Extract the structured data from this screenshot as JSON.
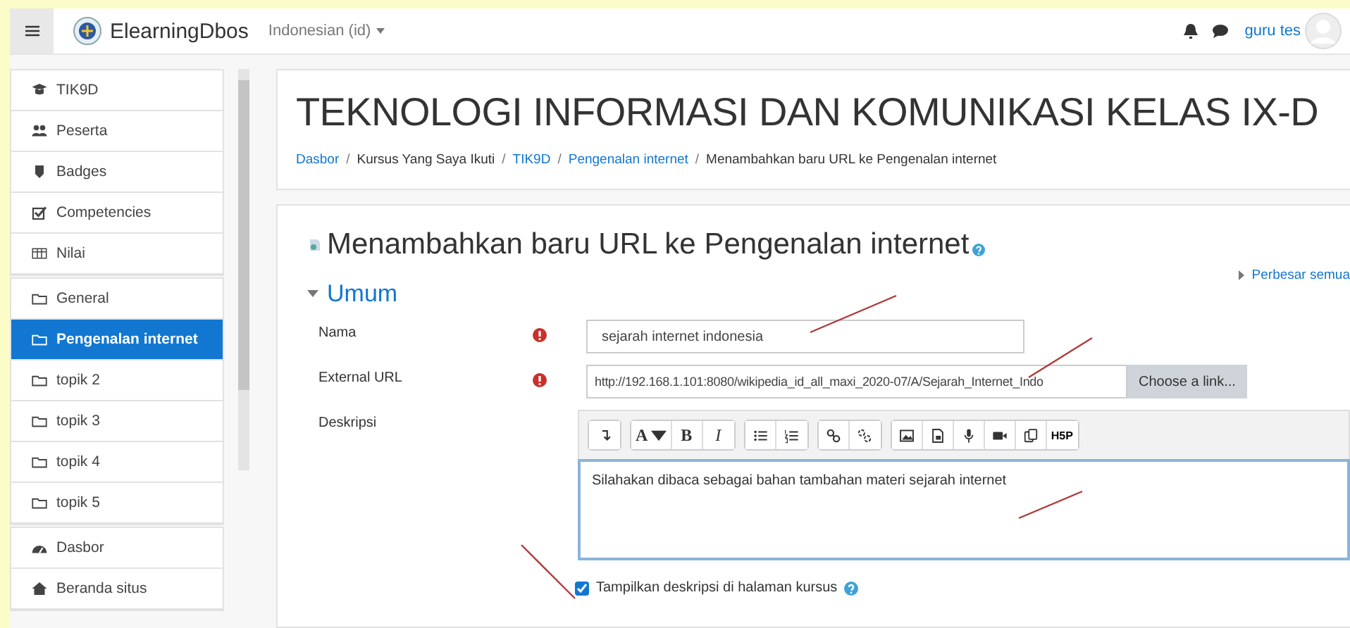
{
  "navbar": {
    "site_name": "ElearningDbos",
    "language": "Indonesian (id)",
    "user_name": "guru tes"
  },
  "sidebar": {
    "groups": [
      {
        "items": [
          {
            "label": "TIK9D",
            "kind": "cap",
            "selected": false
          },
          {
            "label": "Peserta",
            "kind": "users",
            "selected": false
          },
          {
            "label": "Badges",
            "kind": "shield",
            "selected": false
          },
          {
            "label": "Competencies",
            "kind": "check",
            "selected": false
          },
          {
            "label": "Nilai",
            "kind": "table",
            "selected": false
          }
        ]
      },
      {
        "items": [
          {
            "label": "General",
            "kind": "folder",
            "selected": false
          },
          {
            "label": "Pengenalan internet",
            "kind": "folder",
            "selected": true
          },
          {
            "label": "topik 2",
            "kind": "folder",
            "selected": false
          },
          {
            "label": "topik 3",
            "kind": "folder",
            "selected": false
          },
          {
            "label": "topik 4",
            "kind": "folder",
            "selected": false
          },
          {
            "label": "topik 5",
            "kind": "folder",
            "selected": false
          }
        ]
      },
      {
        "items": [
          {
            "label": "Dasbor",
            "kind": "dashboard",
            "selected": false
          },
          {
            "label": "Beranda situs",
            "kind": "home",
            "selected": false
          }
        ]
      }
    ]
  },
  "header": {
    "title": "TEKNOLOGI INFORMASI DAN KOMUNIKASI KELAS IX-D",
    "separator": "/",
    "breadcrumbs": [
      {
        "label": "Dasbor",
        "link": true
      },
      {
        "label": "Kursus Yang Saya Ikuti",
        "link": false
      },
      {
        "label": "TIK9D",
        "link": true
      },
      {
        "label": "Pengenalan internet",
        "link": true
      },
      {
        "label": "Menambahkan baru URL ke Pengenalan internet",
        "link": false
      }
    ]
  },
  "form": {
    "title": "Menambahkan baru URL ke Pengenalan internet",
    "expand_all": "Perbesar semua",
    "section": "Umum",
    "expanded": true,
    "fields": [
      {
        "kind": "text",
        "label": "Nama",
        "required": true,
        "value": "sejarah internet indonesia"
      },
      {
        "kind": "url",
        "label": "External URL",
        "required": true,
        "value": "http://192.168.1.101:8080/wikipedia_id_all_maxi_2020-07/A/Sejarah_Internet_Indo",
        "button": "Choose a link..."
      },
      {
        "kind": "editor",
        "label": "Deskripsi",
        "required": false,
        "value": "Silahakan dibaca sebagai bahan tambahan materi sejarah internet",
        "toolbar": [
          [
            {
              "kind": "expand"
            }
          ],
          [
            {
              "kind": "text",
              "text": "A",
              "dropdown": true
            },
            {
              "kind": "text",
              "text": "B",
              "dropdown": false
            },
            {
              "kind": "text",
              "text": "I",
              "dropdown": false
            }
          ],
          [
            {
              "kind": "bullets"
            },
            {
              "kind": "numbers"
            }
          ],
          [
            {
              "kind": "link"
            },
            {
              "kind": "unlink"
            }
          ],
          [
            {
              "kind": "image"
            },
            {
              "kind": "media"
            },
            {
              "kind": "mic"
            },
            {
              "kind": "video"
            },
            {
              "kind": "copy"
            },
            {
              "kind": "text",
              "text": "H5P",
              "dropdown": false
            }
          ]
        ]
      }
    ],
    "show_description": {
      "label": "Tampilkan deskripsi di halaman kursus",
      "checked": true
    }
  }
}
